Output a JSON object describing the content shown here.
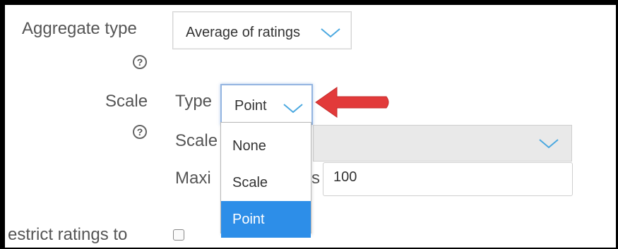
{
  "form": {
    "aggregate": {
      "label": "Aggregate type",
      "value": "Average of ratings"
    },
    "scale": {
      "label": "Scale",
      "type_label": "Type",
      "type_value": "Point",
      "scale_label": "Scale",
      "max_label_visible": "Maxi",
      "max_label_tail": "s",
      "max_value": "100"
    },
    "restrict": {
      "label": "estrict ratings to"
    },
    "help_glyph": "?"
  },
  "dropdown": {
    "options": [
      "None",
      "Scale",
      "Point"
    ],
    "selected": "Point"
  },
  "colors": {
    "selected_option": "#2d8ee8",
    "chevron": "#4aa8e0",
    "arrow": "#e23a3a"
  },
  "icons": {
    "help": "question-circle-icon",
    "chevron": "chevron-down-icon",
    "annotation": "red-arrow-icon"
  }
}
